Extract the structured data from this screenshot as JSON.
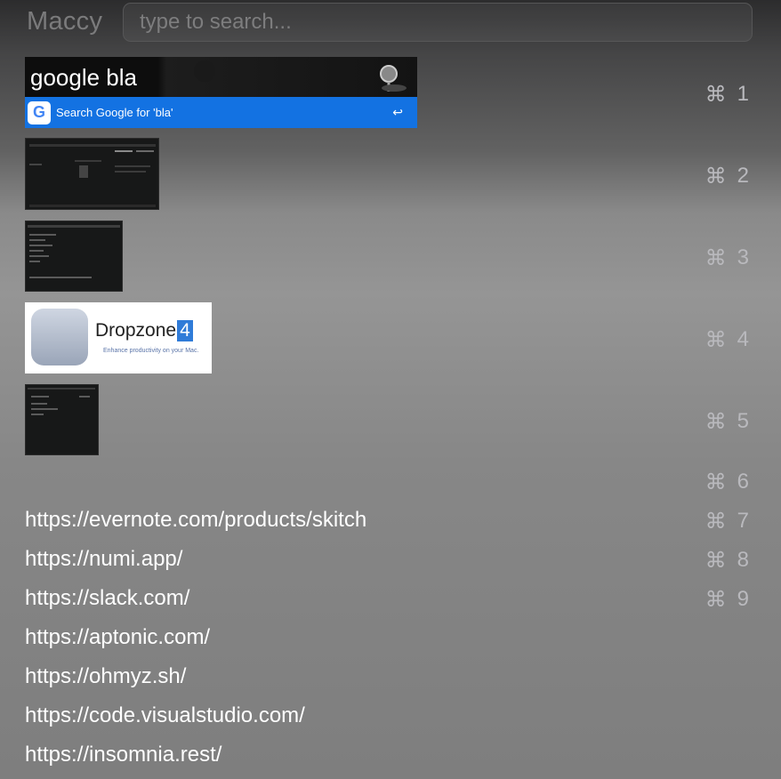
{
  "app": {
    "title": "Maccy"
  },
  "search": {
    "placeholder": "type to search...",
    "value": ""
  },
  "items": {
    "spotlight": {
      "query": "google bla",
      "result": "Search Google for 'bla'"
    },
    "dropzone": {
      "name": "Dropzone",
      "version": "4",
      "tagline": "Enhance productivity on your Mac."
    }
  },
  "shortcuts": [
    {
      "mod": "⌘",
      "key": "1"
    },
    {
      "mod": "⌘",
      "key": "2"
    },
    {
      "mod": "⌘",
      "key": "3"
    },
    {
      "mod": "⌘",
      "key": "4"
    },
    {
      "mod": "⌘",
      "key": "5"
    },
    {
      "mod": "⌘",
      "key": "6"
    },
    {
      "mod": "⌘",
      "key": "7"
    },
    {
      "mod": "⌘",
      "key": "8"
    },
    {
      "mod": "⌘",
      "key": "9"
    }
  ],
  "urls": [
    "https://evernote.com/products/skitch",
    "https://numi.app/",
    "https://slack.com/",
    "https://aptonic.com/",
    "https://ohmyz.sh/",
    "https://code.visualstudio.com/",
    "https://insomnia.rest/"
  ],
  "icons": {
    "google": "google-icon",
    "enter": "return-icon",
    "spotlight": "magnifier-icon"
  }
}
